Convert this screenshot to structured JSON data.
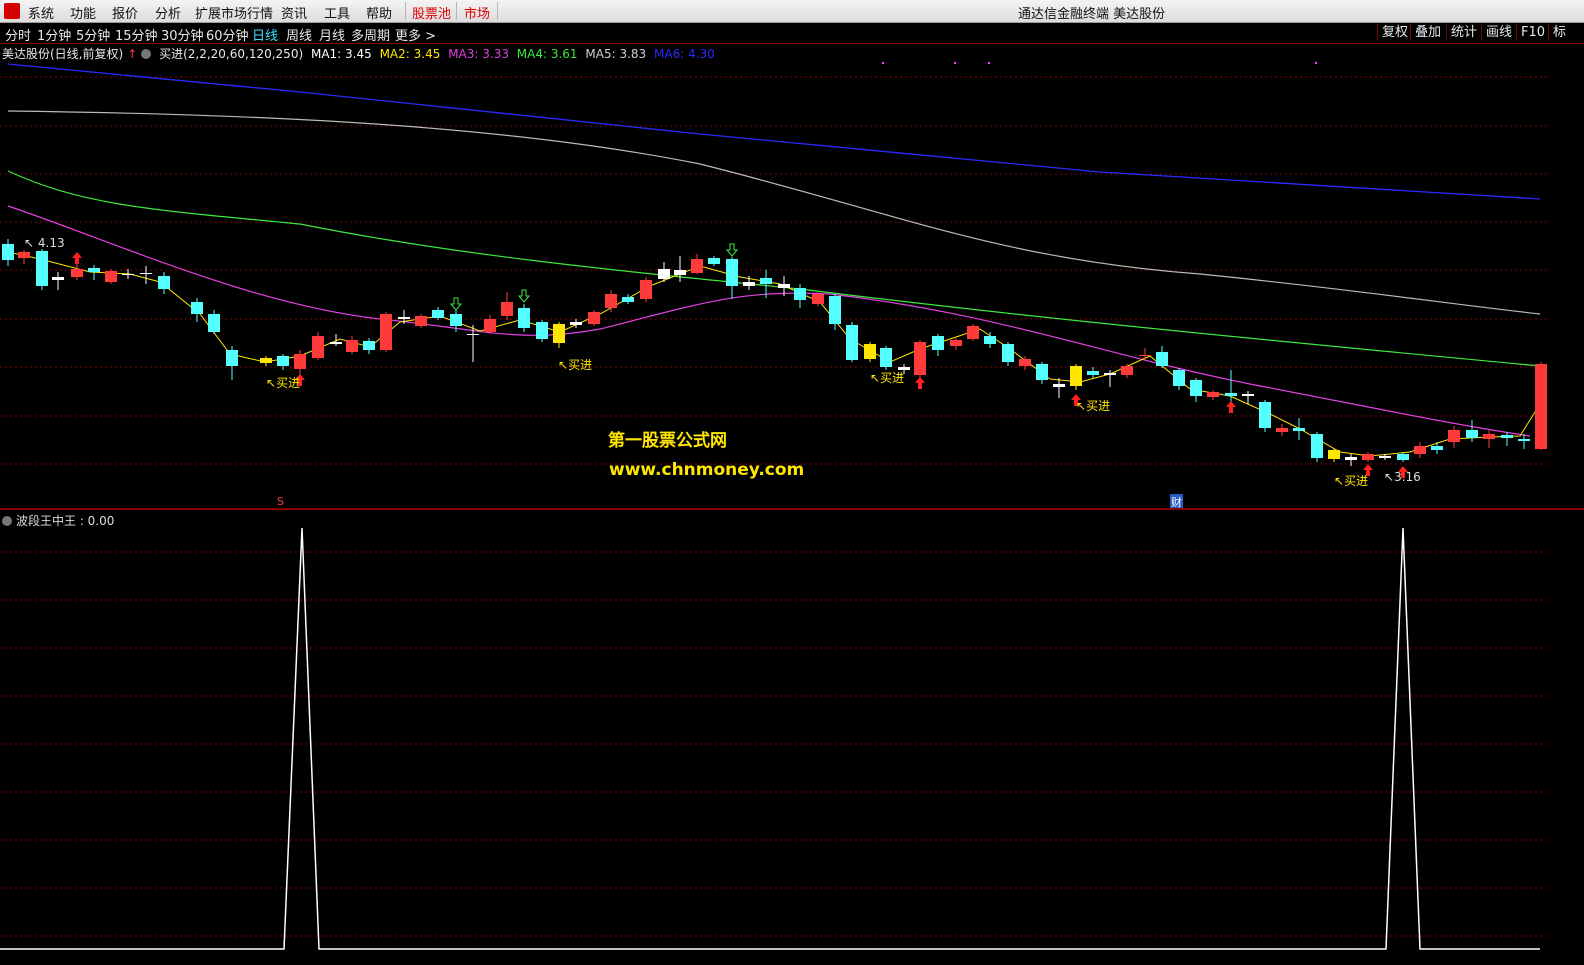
{
  "menu": {
    "items": [
      "系统",
      "功能",
      "报价",
      "分析",
      "扩展市场行情",
      "资讯",
      "工具",
      "帮助"
    ],
    "highlight_items": [
      "股票池",
      "市场"
    ],
    "title": "通达信金融终端 美达股份"
  },
  "periods": {
    "items": [
      "分时",
      "1分钟",
      "5分钟",
      "15分钟",
      "30分钟",
      "60分钟",
      "日线",
      "周线",
      "月线",
      "多周期",
      "更多 >"
    ],
    "active": "日线",
    "right_buttons": [
      "复权",
      "叠加",
      "统计",
      "画线",
      "F10",
      "标"
    ]
  },
  "info": {
    "stock": "美达股份(日线,前复权)",
    "formula": "买进(2,2,20,60,120,250)",
    "ma": [
      {
        "label": "MA1: 3.45",
        "color": "#ffffff"
      },
      {
        "label": "MA2: 3.45",
        "color": "#ffe600"
      },
      {
        "label": "MA3: 3.33",
        "color": "#e040e0"
      },
      {
        "label": "MA4: 3.61",
        "color": "#3ee83e"
      },
      {
        "label": "MA5: 3.83",
        "color": "#cfcfcf"
      },
      {
        "label": "MA6: 4.30",
        "color": "#2a2aff"
      }
    ]
  },
  "chart_labels": {
    "high": "4.13",
    "low": "3.16",
    "buy": "买进",
    "marker_s": "S",
    "marker_cai": "财"
  },
  "watermark": {
    "line1": "第一股票公式网",
    "line2": "www.chnmoney.com"
  },
  "sub": {
    "label": "波段王中王 : 0.00"
  },
  "colors": {
    "up": "#ff3a3a",
    "down": "#54ffff",
    "flat_yellow": "#ffe600",
    "grid": "#8a0000"
  }
}
